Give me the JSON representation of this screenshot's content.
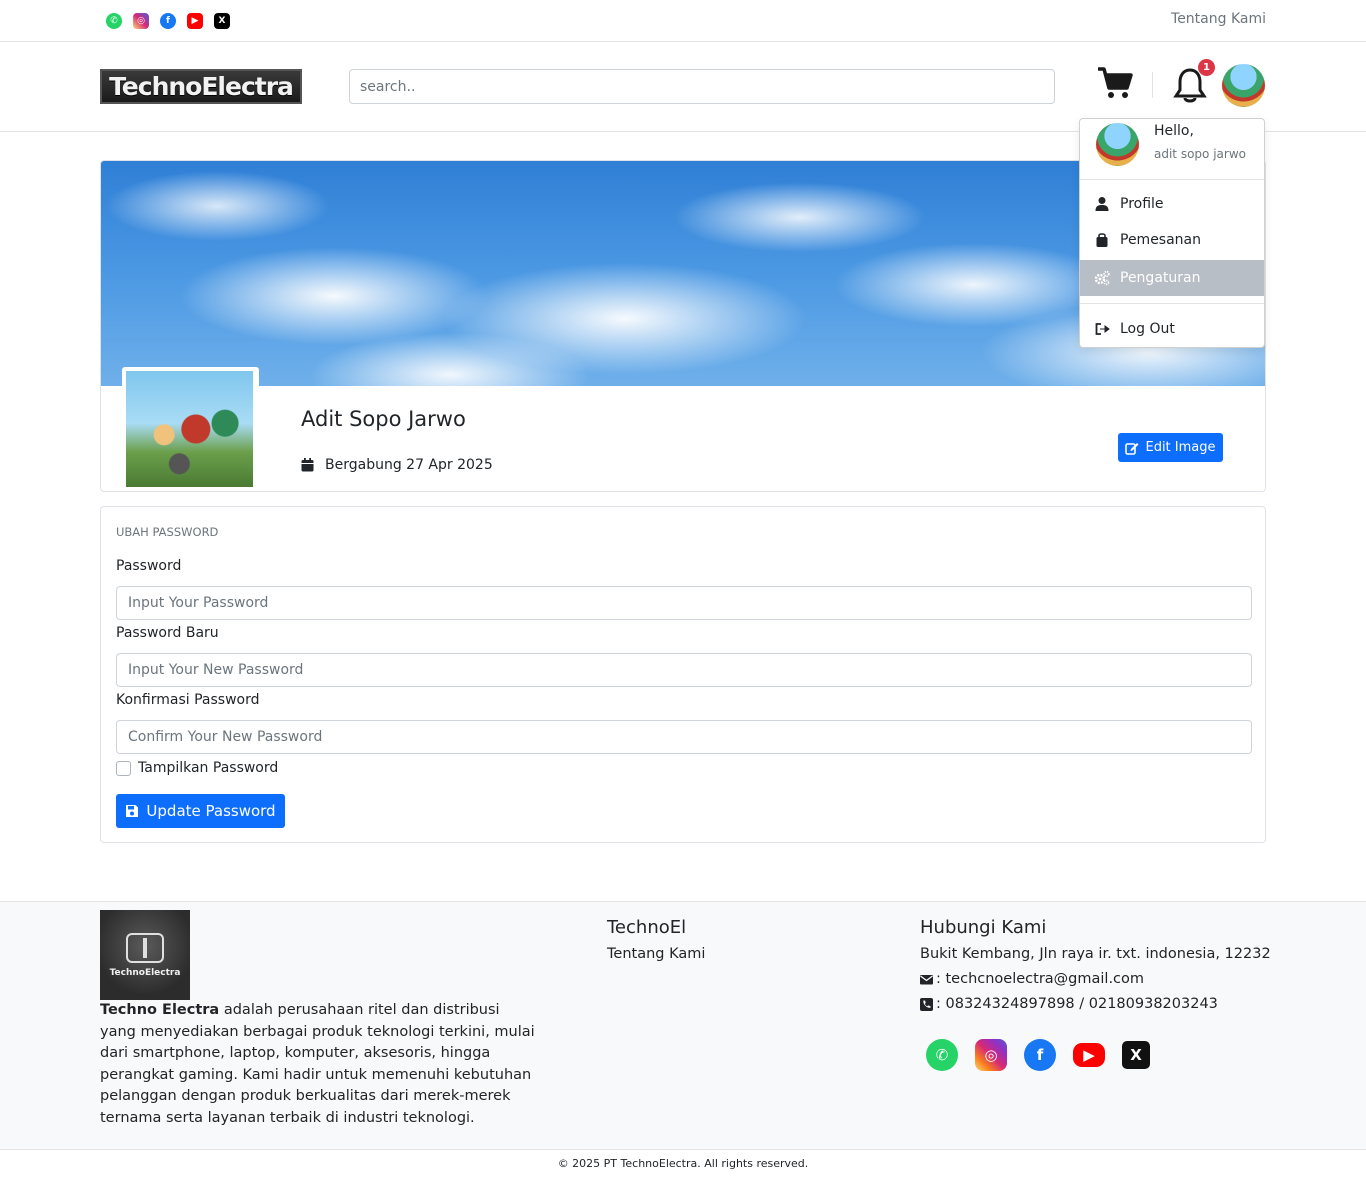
{
  "topbar": {
    "social_icons": [
      "whatsapp-icon",
      "instagram-icon",
      "facebook-icon",
      "youtube-icon",
      "x-icon"
    ],
    "about_link": "Tentang Kami"
  },
  "header": {
    "logo_text": "TechnoElectra",
    "search_placeholder": "search..",
    "notification_count": "1"
  },
  "dropdown": {
    "greeting": "Hello,",
    "username": "adit sopo jarwo",
    "items": [
      {
        "label": "Profile",
        "icon": "user-icon"
      },
      {
        "label": "Pemesanan",
        "icon": "bag-icon"
      },
      {
        "label": "Pengaturan",
        "icon": "gears-icon",
        "active": true
      },
      {
        "label": "Log Out",
        "icon": "sign-out-icon"
      }
    ]
  },
  "profile": {
    "name": "Adit Sopo Jarwo",
    "joined": "Bergabung 27 Apr 2025",
    "edit_button": "Edit Image"
  },
  "password_form": {
    "title": "UBAH PASSWORD",
    "fields": [
      {
        "label": "Password",
        "placeholder": "Input Your Password"
      },
      {
        "label": "Password Baru",
        "placeholder": "Input Your New Password"
      },
      {
        "label": "Konfirmasi Password",
        "placeholder": "Confirm Your New Password"
      }
    ],
    "show_password_label": "Tampilkan Password",
    "show_password_checked": false,
    "submit_label": "Update Password"
  },
  "footer": {
    "logo_text": "TechnoElectra",
    "brand_name": "Techno Electra",
    "description": " adalah perusahaan ritel dan distribusi yang menyediakan berbagai produk teknologi terkini, mulai dari smartphone, laptop, komputer, aksesoris, hingga perangkat gaming. Kami hadir untuk memenuhi kebutuhan pelanggan dengan produk berkualitas dari merek-merek ternama serta layanan terbaik di industri teknologi.",
    "col2_title": "TechnoEl",
    "col2_link": "Tentang Kami",
    "col3_title": "Hubungi Kami",
    "address": "Bukit Kembang, Jln raya ir. txt. indonesia, 12232",
    "email": ": techcnoelectra@gmail.com",
    "phone": ": 08324324897898 / 02180938203243",
    "social_icons": [
      "whatsapp-icon",
      "instagram-icon",
      "facebook-icon",
      "youtube-icon",
      "x-icon"
    ],
    "copyright": "© 2025 PT TechnoElectra. All rights reserved."
  },
  "colors": {
    "primary": "#0d6efd",
    "badge": "#dc3545",
    "active_menu": "#b8bec5",
    "whatsapp": "#25d366",
    "instagram": "#d62976",
    "facebook": "#1877f2",
    "youtube": "#ff0000",
    "x": "#000000"
  }
}
